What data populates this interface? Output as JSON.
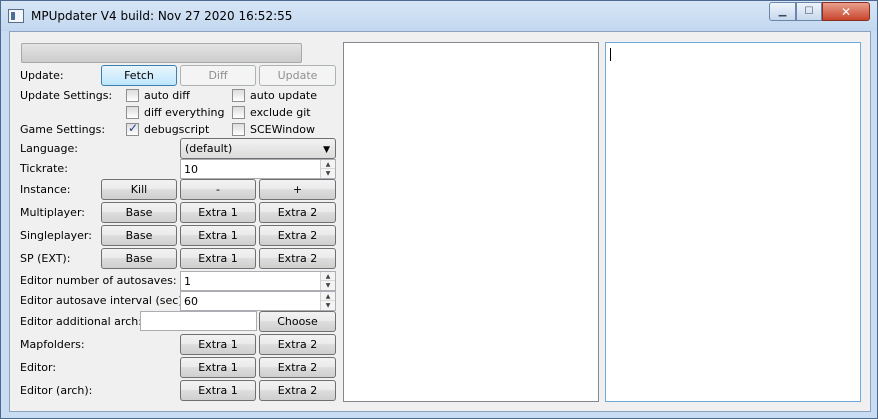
{
  "window": {
    "title": "MPUpdater V4 build: Nov 27 2020 16:52:55"
  },
  "progress": {
    "value": 0
  },
  "update": {
    "label": "Update:",
    "fetch": "Fetch",
    "diff": "Diff",
    "update": "Update"
  },
  "update_settings": {
    "label": "Update Settings:",
    "auto_diff": "auto diff",
    "auto_update": "auto update",
    "diff_everything": "diff everything",
    "exclude_git": "exclude git"
  },
  "game_settings": {
    "label": "Game Settings:",
    "debugscript": "debugscript",
    "scewindow": "SCEWindow",
    "debugscript_checked": true
  },
  "language": {
    "label": "Language:",
    "value": "(default)"
  },
  "tickrate": {
    "label": "Tickrate:",
    "value": "10"
  },
  "instance": {
    "label": "Instance:",
    "kill": "Kill",
    "minus": "-",
    "plus": "+"
  },
  "multiplayer": {
    "label": "Multiplayer:",
    "base": "Base",
    "extra1": "Extra 1",
    "extra2": "Extra 2"
  },
  "singleplayer": {
    "label": "Singleplayer:",
    "base": "Base",
    "extra1": "Extra 1",
    "extra2": "Extra 2"
  },
  "sp_ext": {
    "label": "SP (EXT):",
    "base": "Base",
    "extra1": "Extra 1",
    "extra2": "Extra 2"
  },
  "editor_autosaves": {
    "label": "Editor number of autosaves:",
    "value": "1"
  },
  "editor_interval": {
    "label": "Editor autosave interval (sec):",
    "value": "60"
  },
  "editor_arch": {
    "label": "Editor additional arch:",
    "value": "",
    "choose": "Choose"
  },
  "mapfolders": {
    "label": "Mapfolders:",
    "extra1": "Extra 1",
    "extra2": "Extra 2"
  },
  "editor": {
    "label": "Editor:",
    "extra1": "Extra 1",
    "extra2": "Extra 2"
  },
  "editor_archrow": {
    "label": "Editor (arch):",
    "extra1": "Extra 1",
    "extra2": "Extra 2"
  }
}
